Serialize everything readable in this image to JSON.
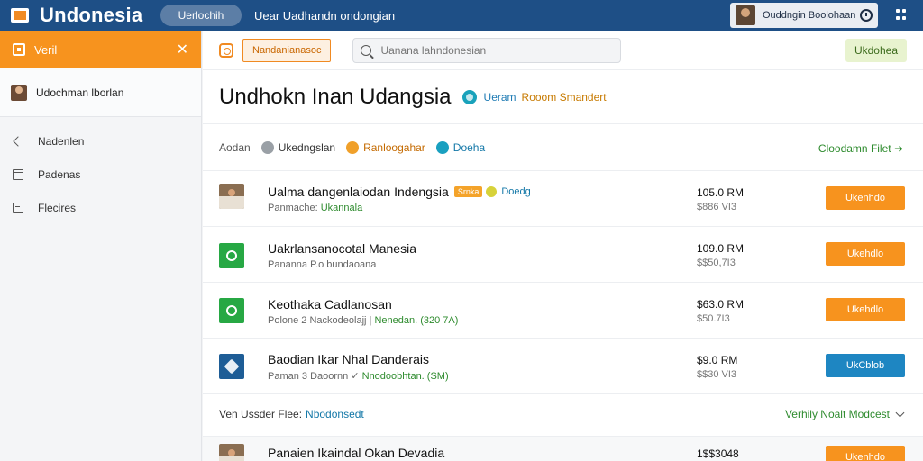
{
  "topbar": {
    "brand": "Undonesia",
    "pill": "Uerlochih",
    "link": "Uear Uadhandn ondongian",
    "user_name": "Ouddngin Boolohaan",
    "colors": {
      "bar": "#1e4f86",
      "accent": "#f08a22"
    }
  },
  "sidebar": {
    "header_label": "Veril",
    "close_glyph": "✕",
    "user_name": "Udochman lborlan",
    "items": [
      {
        "label": "Nadenlen",
        "icon": "back-arrow-icon"
      },
      {
        "label": "Padenas",
        "icon": "box-icon"
      },
      {
        "label": "Flecires",
        "icon": "file-icon"
      }
    ]
  },
  "toolbar": {
    "button_label": "Nandanianasoc",
    "search_placeholder": "Uanana lahndonesian",
    "right_button": "Ukdohea"
  },
  "header": {
    "title": "Undhokn Inan Udangsia",
    "sub1": "Ueram",
    "sub2": "Rooom Smandert"
  },
  "filters": {
    "label": "Aodan",
    "chips": [
      "Ukedngslan",
      "Ranloogahar",
      "Doeha"
    ],
    "download": "Cloodamn Filet ➜"
  },
  "rows": [
    {
      "title": "Ualma dangenlaiodan Indengsia",
      "tag": "Srnka",
      "tag_link": "Doedg",
      "sub": "Panmache:",
      "sub_hl": "Ukannala",
      "price": "105.0 RM",
      "price2": "$886 VI3",
      "action": "Ukenhdo",
      "thumb": "photo"
    },
    {
      "title": "Uakrlansanocotal Manesia",
      "tag": "",
      "tag_link": "",
      "sub": "Pananna P.o bundaoana",
      "sub_hl": "",
      "price": "109.0 RM",
      "price2": "$$50,7I3",
      "action": "Ukehdlo",
      "thumb": "green"
    },
    {
      "title": "Keothaka Cadlanosan",
      "tag": "",
      "tag_link": "",
      "sub": "Polone 2 Nackodeolajj |",
      "sub_hl": "Nenedan. (320 7A)",
      "price": "$63.0 RM",
      "price2": "$50.7I3",
      "action": "Ukehdlo",
      "thumb": "green"
    },
    {
      "title": "Baodian Ikar Nhal Danderais",
      "tag": "",
      "tag_link": "",
      "sub": "Paman 3 Daoornn ✓",
      "sub_hl": "Nnodoobhtan. (SM)",
      "price": "$9.0 RM",
      "price2": "$$30 VI3",
      "action": "UkCblob",
      "thumb": "blue"
    }
  ],
  "footer": {
    "label": "Ven Ussder Flee:",
    "link": "Nbodonsedt",
    "right": "Verhily Noalt Modcest"
  },
  "last_row": {
    "title": "Panaien Ikaindal Okan Devadia",
    "price": "1$$3048",
    "action": "Ukenhdo"
  }
}
